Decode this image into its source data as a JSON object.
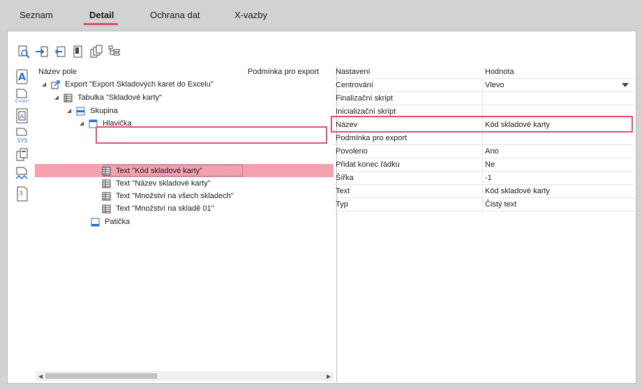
{
  "tabs": [
    {
      "label": "Seznam"
    },
    {
      "label": "Detail"
    },
    {
      "label": "Ochrana dat"
    },
    {
      "label": "X-vazby"
    }
  ],
  "active_tab": "Detail",
  "toolbar": {
    "icons": [
      "preview-search-icon",
      "import-icon",
      "export-icon",
      "page-icon",
      "copy-icon",
      "structure-icon"
    ]
  },
  "side_icons": [
    "text-field-icon",
    "formula-icon",
    "variable-icon",
    "system-icon",
    "copy-page-icon",
    "chart-page-icon",
    "numbered-page-icon"
  ],
  "tree": {
    "col_name": "Název pole",
    "col_condition": "Podmínka pro export",
    "nodes": [
      {
        "label": "Export \"Export Skladových karet do Excelu\""
      },
      {
        "label": "Tabulka \"Skladové karty\""
      },
      {
        "label": "Skupina"
      },
      {
        "label": "Hlavička"
      },
      {
        "label": "Text \"Kód skladové karty\""
      },
      {
        "label": "Text \"Název skladové karty\""
      },
      {
        "label": "Text \"Množství na všech skladech\""
      },
      {
        "label": "Text \"Množství na skladě 01\""
      },
      {
        "label": "Patička"
      }
    ],
    "selected_index": 4
  },
  "props": {
    "col_key": "Nastavení",
    "col_value": "Hodnota",
    "rows": [
      {
        "key": "Centrování",
        "value": "Vlevo"
      },
      {
        "key": "Finalizační skript",
        "value": ""
      },
      {
        "key": "Inicializační skript",
        "value": ""
      },
      {
        "key": "Název",
        "value": "Kód skladové karty"
      },
      {
        "key": "Podmínka pro export",
        "value": ""
      },
      {
        "key": "Povoleno",
        "value": "Ano"
      },
      {
        "key": "Přidat konec řádku",
        "value": "Ne"
      },
      {
        "key": "Šířka",
        "value": "-1"
      },
      {
        "key": "Text",
        "value": "Kód skladové karty"
      },
      {
        "key": "Typ",
        "value": "Čistý text"
      }
    ]
  },
  "colors": {
    "accent": "#e04a6a",
    "selection": "#f3a1b1",
    "icon_blue": "#2a6fd0"
  }
}
